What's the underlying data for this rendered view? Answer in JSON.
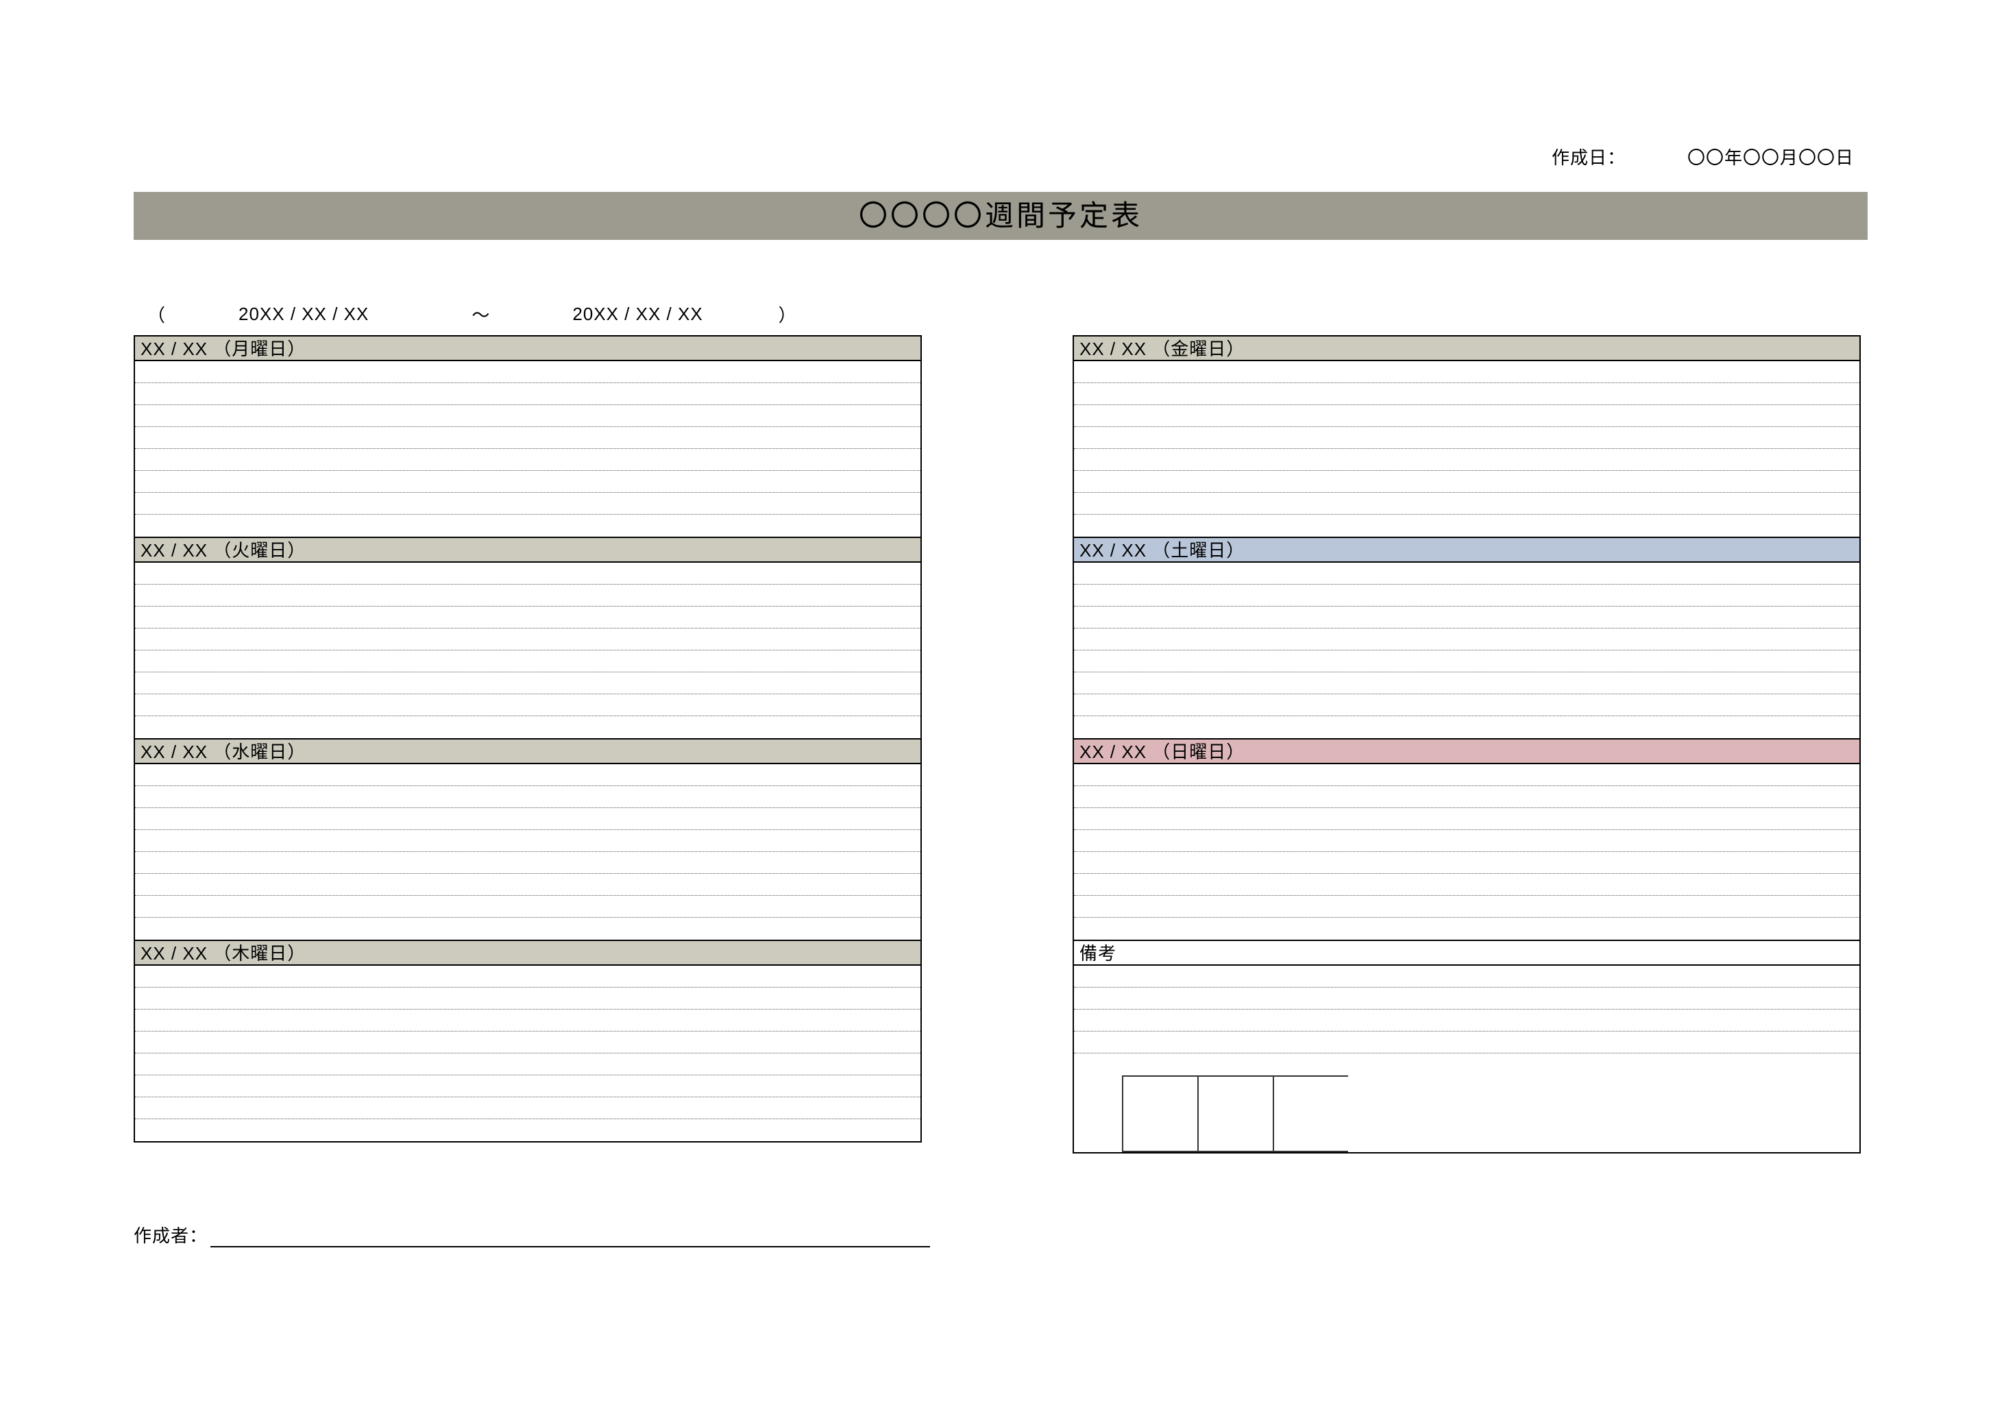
{
  "meta": {
    "creation_label": "作成日：",
    "creation_value": "〇〇年〇〇月〇〇日"
  },
  "title": "〇〇〇〇週間予定表",
  "range": {
    "open": "（",
    "from": "20XX / XX / XX",
    "sep": "〜",
    "to": "20XX / XX / XX",
    "close": "）"
  },
  "left_days": [
    {
      "label": "XX / XX （月曜日）",
      "header_class": "hdr-default",
      "rows": 8
    },
    {
      "label": "XX / XX （火曜日）",
      "header_class": "hdr-default",
      "rows": 8
    },
    {
      "label": "XX / XX （水曜日）",
      "header_class": "hdr-default",
      "rows": 8
    },
    {
      "label": "XX / XX （木曜日）",
      "header_class": "hdr-default",
      "rows": 8
    }
  ],
  "right_days": [
    {
      "label": "XX / XX （金曜日）",
      "header_class": "hdr-default",
      "rows": 8
    },
    {
      "label": "XX / XX （土曜日）",
      "header_class": "hdr-sat",
      "rows": 8
    },
    {
      "label": "XX / XX （日曜日）",
      "header_class": "hdr-sun",
      "rows": 8
    }
  ],
  "notes": {
    "label": "備考",
    "rows": 5,
    "stamp_boxes": 3
  },
  "author": {
    "label": "作成者："
  }
}
